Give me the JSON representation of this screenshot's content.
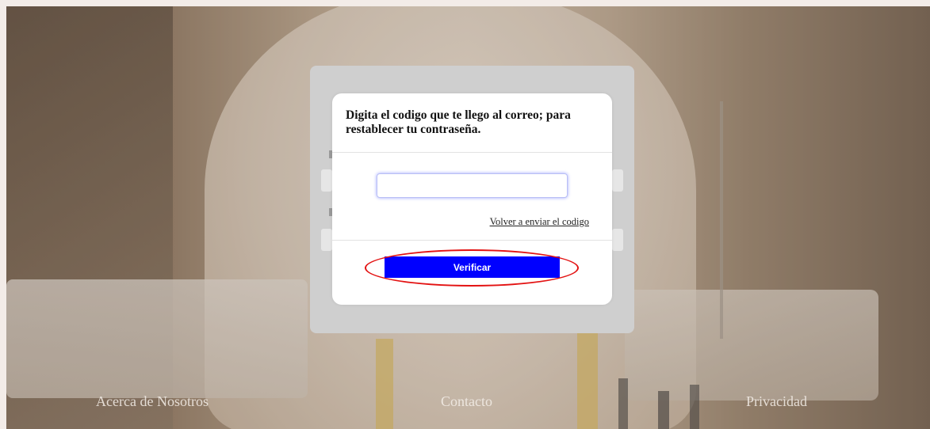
{
  "modal": {
    "title": "Digita el codigo que te llego al correo; para restablecer tu contraseña.",
    "code_input": {
      "value": "",
      "placeholder": ""
    },
    "resend_link": "Volver a enviar el codigo",
    "verify_button": "Verificar"
  },
  "footer": {
    "about": "Acerca de Nosotros",
    "contact": "Contacto",
    "privacy": "Privacidad"
  },
  "colors": {
    "verify_button_bg": "#0000ff",
    "highlight": "#e31212",
    "input_focus": "#9aa2ff"
  }
}
